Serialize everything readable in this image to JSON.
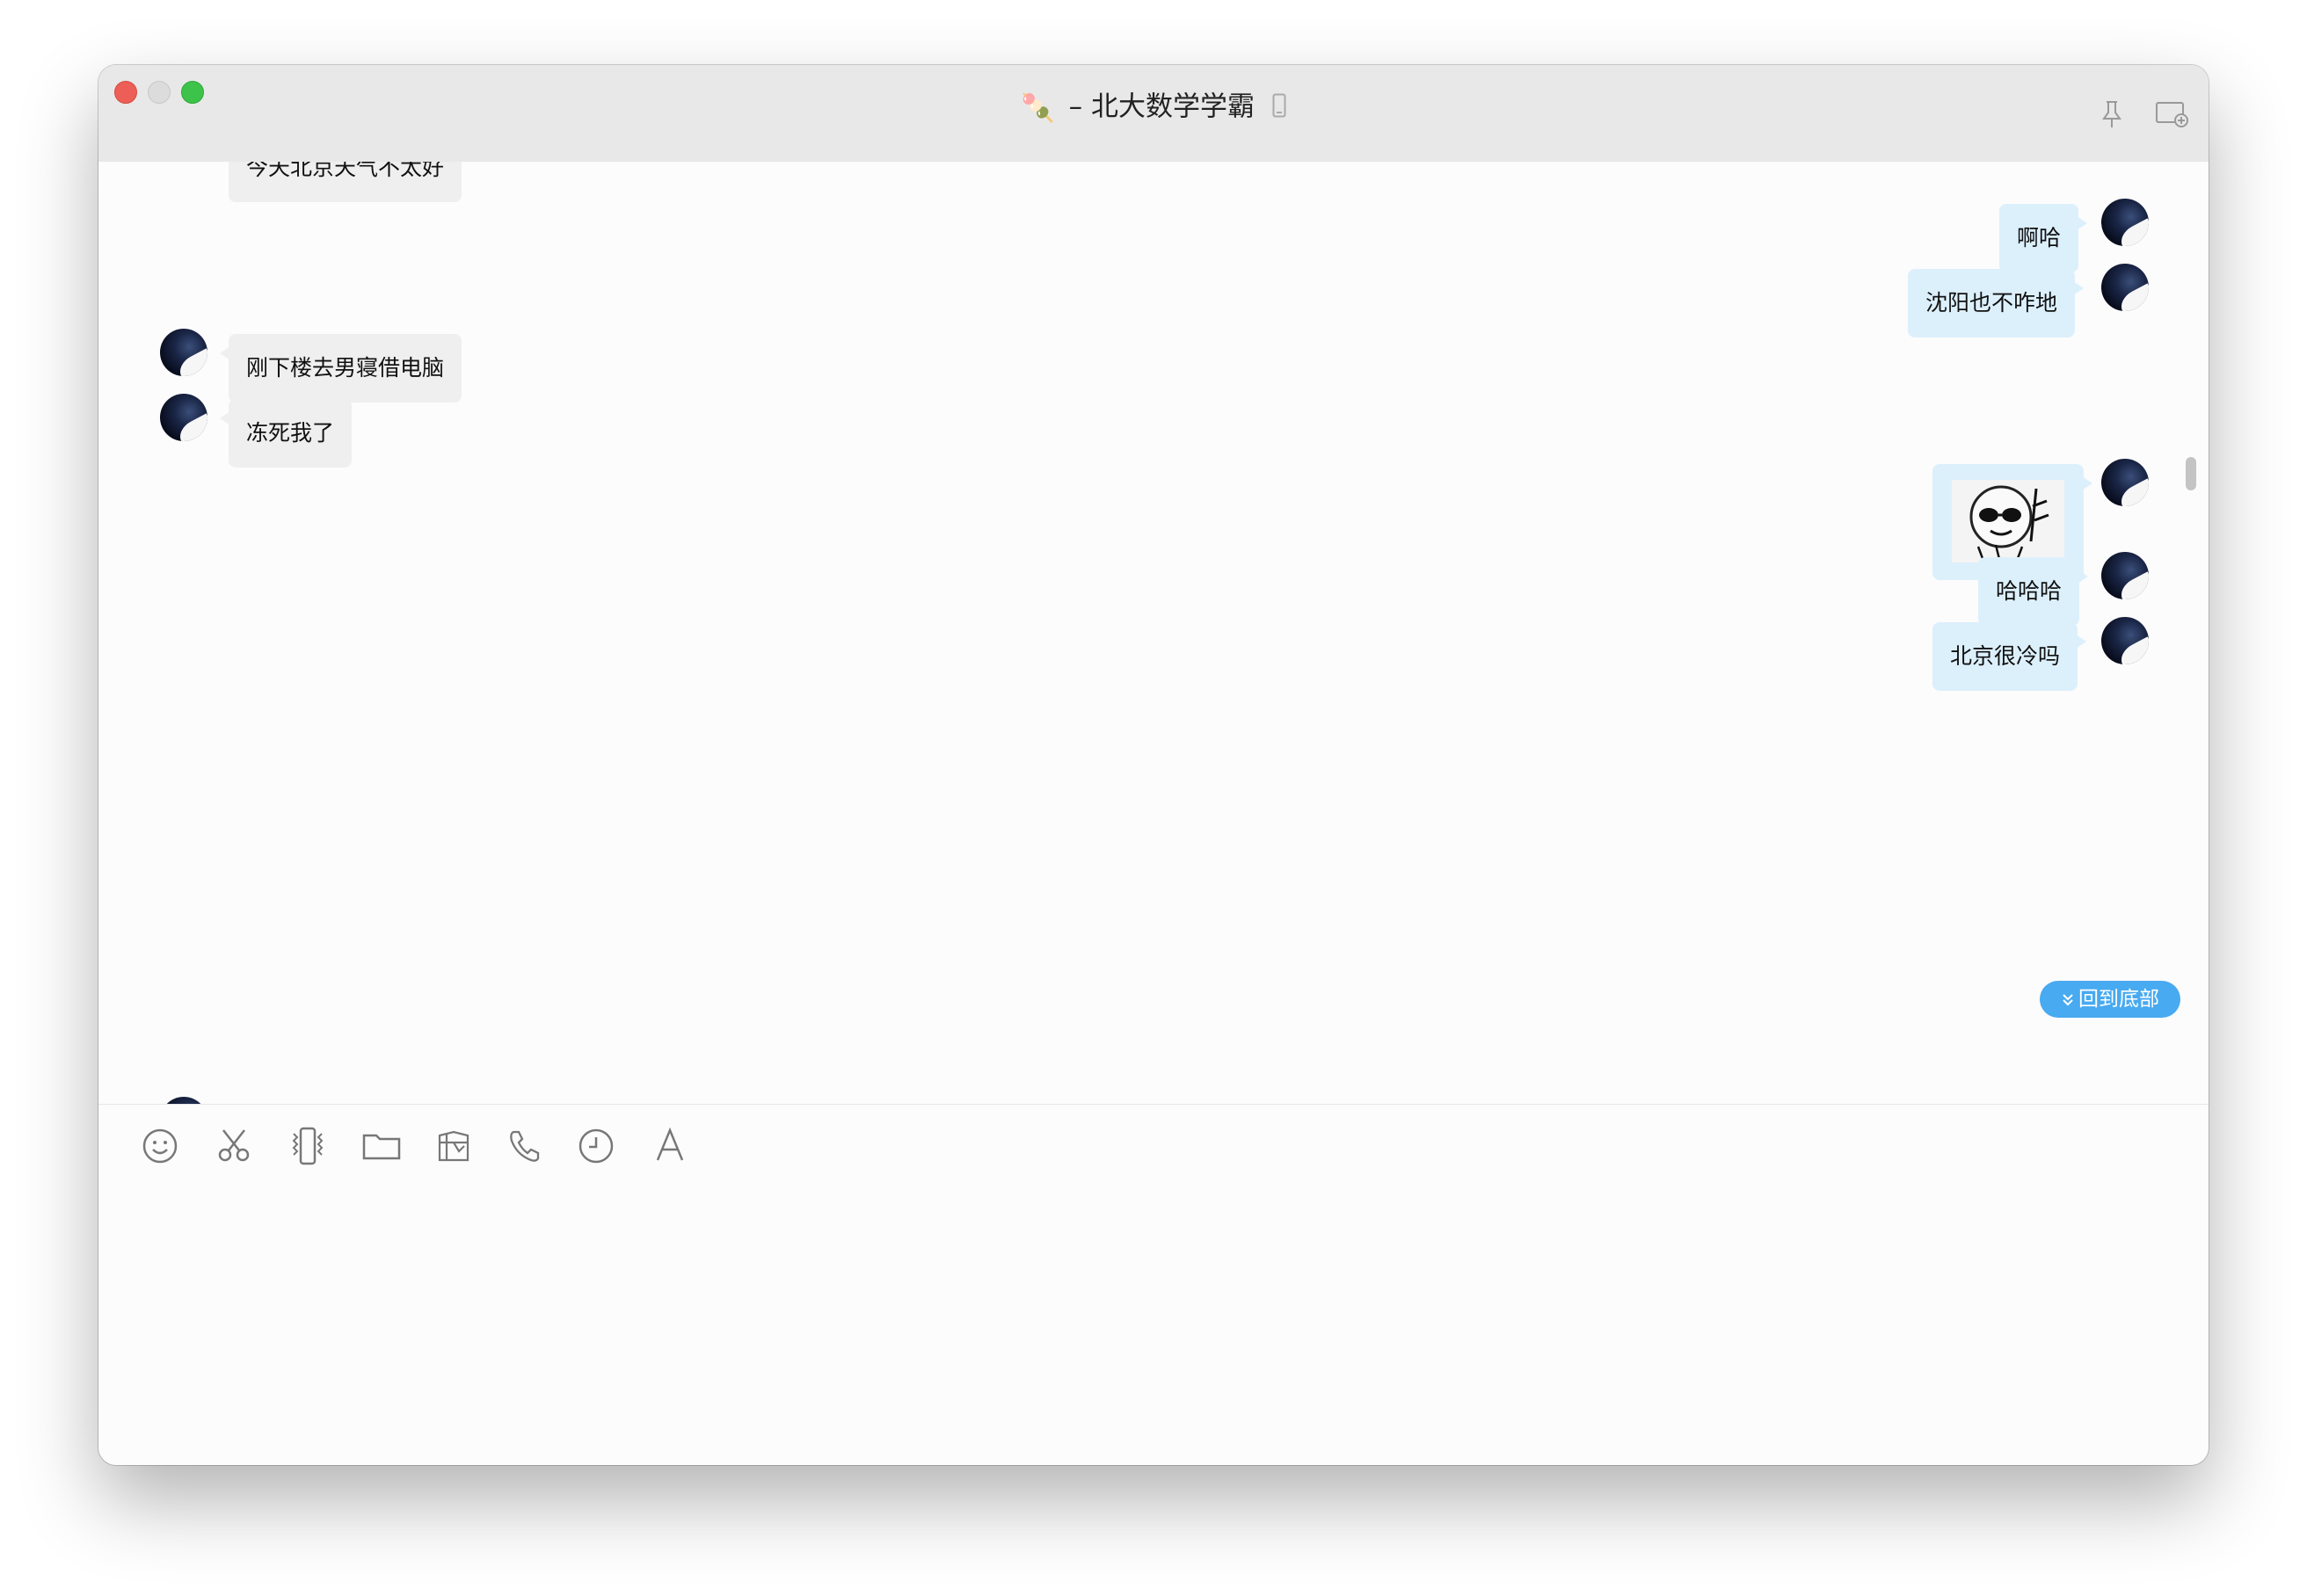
{
  "window": {
    "title_emoji": "🍡",
    "title": "– 北大数学学霸"
  },
  "messages": [
    {
      "side": "in",
      "text": "今天北京天气不太好"
    },
    {
      "side": "out",
      "text": "啊哈"
    },
    {
      "side": "out",
      "text": "沈阳也不咋地"
    },
    {
      "side": "in",
      "text": "刚下楼去男寝借电脑"
    },
    {
      "side": "in",
      "text": "冻死我了"
    },
    {
      "side": "out",
      "type": "sticker"
    },
    {
      "side": "out",
      "text": "哈哈哈"
    },
    {
      "side": "out",
      "text": "北京很冷吗"
    }
  ],
  "back_to_bottom": {
    "label": "回到底部"
  },
  "toolbar": {
    "items": [
      "emoji-icon",
      "scissors-icon",
      "vibrate-icon",
      "folder-icon",
      "gift-icon",
      "phone-icon",
      "clock-icon",
      "font-icon"
    ]
  },
  "colors": {
    "bubble_out": "#dcf0fc",
    "bubble_in": "#efefef",
    "accent": "#48aaf0"
  }
}
